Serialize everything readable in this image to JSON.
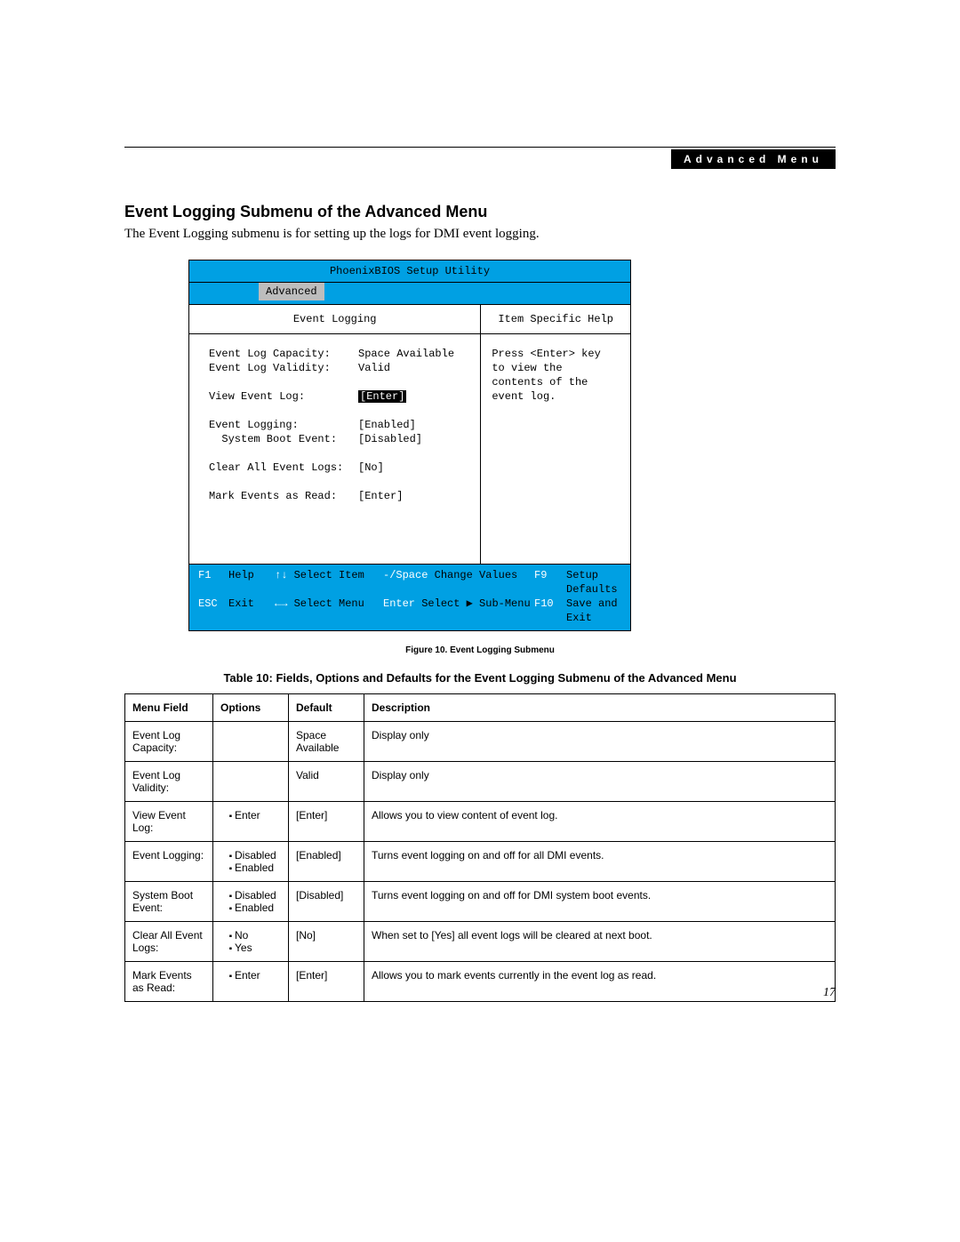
{
  "header": {
    "section": "Advanced Menu"
  },
  "heading": "Event Logging Submenu of the Advanced Menu",
  "intro": "The Event Logging submenu is for setting up the logs for DMI event logging.",
  "bios": {
    "title": "PhoenixBIOS Setup Utility",
    "tab": "Advanced",
    "left_head": "Event Logging",
    "right_head": "Item Specific Help",
    "help": "Press <Enter> key to view the contents of the event log.",
    "rows": [
      {
        "label": "Event Log Capacity:",
        "value": "Space Available"
      },
      {
        "label": "Event Log Validity:",
        "value": "Valid"
      },
      {
        "blank": true
      },
      {
        "label": "View Event Log:",
        "value": "[Enter]",
        "hl": true
      },
      {
        "blank": true
      },
      {
        "label": "Event Logging:",
        "value": "[Enabled]"
      },
      {
        "label": "  System Boot Event:",
        "value": "[Disabled]"
      },
      {
        "blank": true
      },
      {
        "label": "Clear All Event Logs:",
        "value": "[No]"
      },
      {
        "blank": true
      },
      {
        "label": "Mark Events as Read:",
        "value": "[Enter]"
      }
    ],
    "foot": {
      "r1": {
        "k1": "F1",
        "t1": "Help",
        "a1": "↑↓",
        "t2": "Select Item",
        "k2": "-/Space",
        "t3": "Change Values",
        "k3": "F9",
        "t4": "Setup Defaults"
      },
      "r2": {
        "k1": "ESC",
        "t1": "Exit",
        "a1": "←→",
        "t2": "Select Menu",
        "k2": "Enter",
        "t3": "Select ▶ Sub-Menu",
        "k3": "F10",
        "t4": "Save and Exit"
      }
    }
  },
  "figure_caption": "Figure 10.  Event Logging Submenu",
  "table_caption": "Table 10: Fields, Options and Defaults for the Event Logging Submenu of the Advanced Menu",
  "table": {
    "headers": [
      "Menu Field",
      "Options",
      "Default",
      "Description"
    ],
    "rows": [
      {
        "field": "Event Log Capacity:",
        "options": [],
        "default": "Space Available",
        "desc": "Display only"
      },
      {
        "field": "Event Log Validity:",
        "options": [],
        "default": "Valid",
        "desc": "Display only"
      },
      {
        "field": "View Event Log:",
        "options": [
          "Enter"
        ],
        "default": "[Enter]",
        "desc": "Allows you to view content of event log."
      },
      {
        "field": "Event Logging:",
        "options": [
          "Disabled",
          "Enabled"
        ],
        "default": "[Enabled]",
        "desc": "Turns event logging on and off for all DMI events."
      },
      {
        "field": "System Boot Event:",
        "options": [
          "Disabled",
          "Enabled"
        ],
        "default": "[Disabled]",
        "desc": "Turns event logging on and off for DMI system boot events."
      },
      {
        "field": "Clear All Event Logs:",
        "options": [
          "No",
          "Yes"
        ],
        "default": "[No]",
        "desc": "When set to [Yes] all event logs will be cleared at next boot."
      },
      {
        "field": "Mark Events as Read:",
        "options": [
          "Enter"
        ],
        "default": "[Enter]",
        "desc": "Allows you to mark events currently in the event log as read."
      }
    ]
  },
  "page_number": "17"
}
